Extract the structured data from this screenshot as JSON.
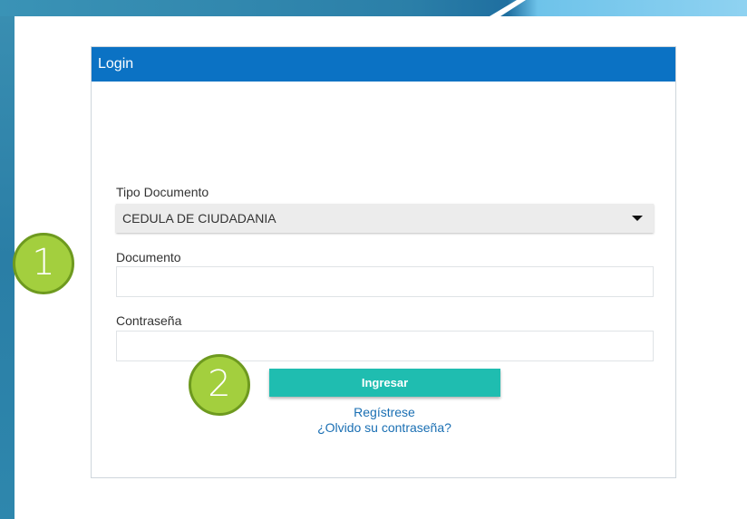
{
  "login": {
    "title": "Login",
    "tipo_documento": {
      "label": "Tipo Documento",
      "selected": "CEDULA DE CIUDADANIA"
    },
    "documento": {
      "label": "Documento",
      "value": "",
      "placeholder": ""
    },
    "contrasena": {
      "label": "Contraseña",
      "value": "",
      "placeholder": ""
    },
    "submit_label": "Ingresar",
    "register_link": "Regístrese",
    "forgot_link": "¿Olvido su contraseña?"
  },
  "callouts": {
    "first": "1",
    "second": "2"
  },
  "colors": {
    "header": "#0b72c4",
    "button": "#1fbdb0",
    "link": "#1a6fb3",
    "callout": "#a3cf3e"
  }
}
